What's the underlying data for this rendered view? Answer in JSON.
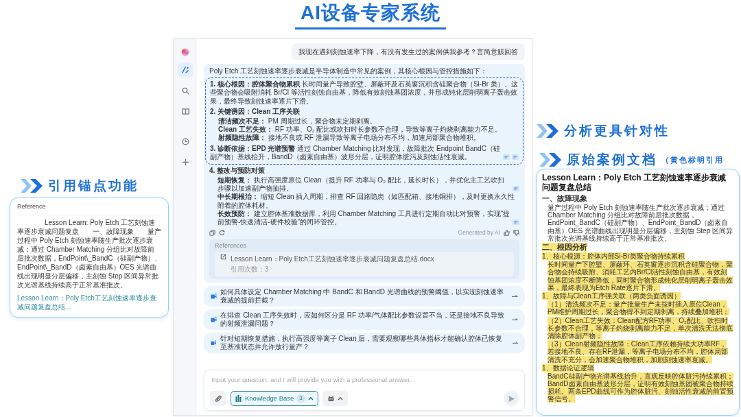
{
  "slide": {
    "title": "AI设备专家系统"
  },
  "sidebar": {
    "items": [
      {
        "kind": "pen",
        "selected": true
      },
      {
        "kind": "search",
        "selected": false
      },
      {
        "kind": "book",
        "selected": false
      },
      {
        "kind": "clock",
        "selected": false
      },
      {
        "kind": "plus",
        "selected": false
      }
    ]
  },
  "chat": {
    "user_message": "我现在遇到刻蚀速率下降，有没有发生过的案例供我参考？言简意赅回答",
    "answer": {
      "intro": "Poly Etch 工艺刻蚀速率逐步衰减是半导体制造中常见的案例，其核心根因与管控措施如下：",
      "sections": [
        {
          "kind": "paragraph",
          "title": "1. 核心根因：腔体聚合物累积",
          "text": "长时间量产导致腔壁、屏蔽环及石英窗沉积含硅聚合物（Si-Br 类）。这些聚合物会吸附消耗 Br/Cl 等活性刻蚀自由基，降低有效刻蚀基团浓度，并形成钝化层削弱离子轰击效果，最终导致刻蚀速率逐片下滑。",
          "highlighted": true
        },
        {
          "kind": "list",
          "title": "2. 关键诱因：Clean 工序关联",
          "highlighted": true,
          "items": [
            {
              "label": "清洁频次不足：",
              "text": "PM 周期过长，聚合物未定期剥离。"
            },
            {
              "label": "Clean 工艺失效：",
              "text": "RF 功率、O₂ 配比或吹扫时长参数不合理，导致等离子灼烧剥离能力不足。"
            },
            {
              "label": "射频隐性故障：",
              "text": "接地不良或 RF 泄漏导致等离子电场分布不均，加速局部聚合物堆积。"
            }
          ]
        },
        {
          "kind": "paragraph",
          "title": "3. 诊断依据：EPD 光谱预警",
          "text": "通过 Chamber Matching 比对发现，故障批次 Endpoint BandC（硅副产物）基线抬升，BandD（卤素自由基）波形分层，证明腔体脏污及刻蚀活性衰减。",
          "highlighted": true,
          "citations": [
            {
              "kind": "doc"
            },
            {
              "kind": "doc"
            }
          ]
        },
        {
          "kind": "list",
          "title": "4. 整改与预防对策",
          "highlighted": false,
          "items": [
            {
              "label": "短期恢复：",
              "text": "执行高强度原位 Clean（提升 RF 功率与 O₂ 配比，延长时长），并优化主工艺吹扫步骤以加速副产物抽排。",
              "citations": [
                {
                  "kind": "doc"
                }
              ]
            },
            {
              "label": "中长期根治：",
              "text": "缩短 Clean 插入周期，排查 RF 回路隐患（如匹配箱、接地铜排），及时更换永久性附着的腔体耗材。"
            },
            {
              "label": "长效预防：",
              "text": "建立腔体基准数据库，利用 Chamber Matching 工具进行定期自动比对预警，实现“提前预警-快速清洁-硬件校验”的闭环管控。",
              "citations": [
                {
                  "kind": "doc"
                }
              ]
            }
          ]
        }
      ],
      "generated_label": "Generated by AI",
      "references": {
        "title": "References",
        "items": [
          {
            "name": "Lesson Learn：Poly Etch工艺刻蚀速率逐步衰减问题复盘总结.docx",
            "count": "引用次数：3"
          }
        ]
      }
    },
    "suggestions": [
      "如何具体设定 Chamber Matching 中 BandC 和 BandD 光谱曲线的预警阈值，以实现刻蚀速率衰减的提前拦截？",
      "在排查 Clean 工序失效时，应如何区分是 RF 功率/气体配比参数设置不当，还是接地不良导致的射频泄漏问题？",
      "针对短期恢复措施，执行高强度等离子 Clean 后，需要观察哪些具体指标才能确认腔体已恢复至基准状态并允许放行量产？"
    ],
    "input": {
      "placeholder": "Input your question, and I will provide you with a professional answer...",
      "knowledge_base": {
        "label": "Knowledge Base",
        "count": "3",
        "selected": true
      }
    }
  },
  "callouts": {
    "reference_popup": {
      "heading": "引用锚点功能",
      "title": "Reference",
      "text": "Lesson Learn: Poly Etch 工艺刻蚀速率逐步衰减问题复盘　　一、故障现象　　量产过程中 Poly Etch 刻蚀速率随生产批次逐步衰减；通过 Chamber Matching 分组比对故障前后批次数据，EndPoint\\_BandC（硅副产物）、EndPoint\\_BandD（卤素自由基）OES 光谱曲线出现明显分层偏移，主刻蚀 Step 区间异常批次光谱基线持续高于正常基准批次。",
      "link": "Lesson Learn：Poly Etch工艺刻蚀速率逐步衰减问题复盘总结..."
    },
    "analysis": {
      "heading": "分析更具针对性"
    },
    "document": {
      "heading": "原始案例文档",
      "note": "（黄色标明引用",
      "title": "Lesson Learn：Poly Etch 工艺刻蚀速率逐步衰减问题复盘总结",
      "blocks": [
        {
          "kind": "heading",
          "text": "一、故障现象",
          "highlighted": false
        },
        {
          "kind": "paragraph",
          "text": "量产过程中 Poly Etch 刻蚀速率随生产批次逐步衰减；通过 Chamber Matching 分组比对故障前后批次数据，EndPoint_BandC（硅副产物）、EndPoint_BandD（卤素自由基）OES 光谱曲线出现明显分层偏移，主刻蚀 Step 区间异常批次光谱基线持续高于正常基准批次。",
          "highlighted": false
        },
        {
          "kind": "heading",
          "text": "二、根因分析",
          "highlighted": true
        },
        {
          "kind": "item",
          "text": "1、核心根源：腔体内部Si-Br类聚合物持续累积",
          "highlighted": true
        },
        {
          "kind": "paragraph",
          "text": "长时间量产下腔壁、屏蔽环、石英窗逐步沉积含硅聚合物，聚合物会持续吸附、消耗工艺内Br/Cl活性刻蚀自由基，有效刻蚀基团浓度不断降低，同时聚合物形成钝化层削弱离子轰击效果，最终表现为Etch Rate逐片下滑。",
          "highlighted": true
        },
        {
          "kind": "item",
          "text": "1、故障与Clean工序强关联（两类负面诱因）",
          "highlighted": true
        },
        {
          "kind": "paragraph",
          "text": "（1）清洗频次不足：量产批量生产未按时插入原位Clean，PM维护周期过长，聚合物得不到定期剥离，持续叠加堆积；",
          "highlighted": true
        },
        {
          "kind": "paragraph",
          "text": "（2）Clean工艺失效：Clean配方RF功率、O₂配比、吹扫时长参数不合理，等离子灼烧剥离能力不足，单次清洗无法彻底清除腔体副产物；",
          "highlighted": true
        },
        {
          "kind": "paragraph",
          "text": "（3）Clean射频隐性故障：Clean工序依赖持续大功率RF，若接地不良、存在RF泄漏，等离子电场分布不均，腔体局部清洗不充分，会加速聚合物堆积，加剧刻蚀速率衰减。",
          "highlighted": true
        },
        {
          "kind": "item",
          "text": "1、数据论证逻辑",
          "highlighted": true
        },
        {
          "kind": "paragraph",
          "text": "BandC硅副产物光谱基线抬升，直观反映腔体脏污持续累积；BandD卤素自由基波形分层，证明有效刻蚀基团被聚合物持续损耗。两条EPD曲线可作为腔体脏污、刻蚀活性衰减的前置预警信号。",
          "highlighted": true
        }
      ]
    }
  }
}
